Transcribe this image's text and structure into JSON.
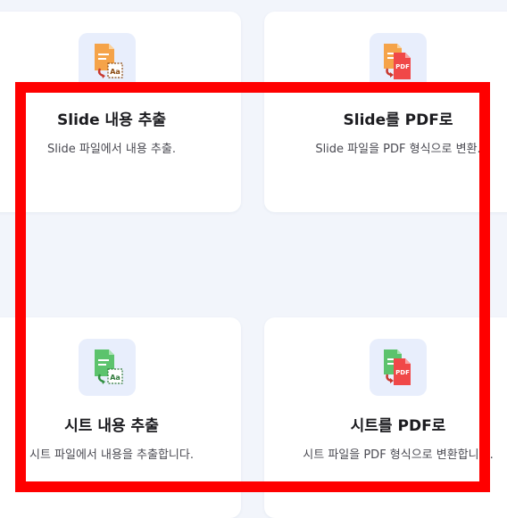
{
  "cards": [
    {
      "title": "Slide 내용 추출",
      "description": "Slide 파일에서 내용 추출.",
      "icon": "slide-extract-icon",
      "doc_color": "#f5a349",
      "badge_text": "Aa"
    },
    {
      "title": "Slide를 PDF로",
      "description": "Slide 파일을 PDF 형식으로 변환.",
      "icon": "slide-to-pdf-icon",
      "doc_color": "#f5a349",
      "badge_text": "PDF"
    },
    {
      "title": "시트 내용 추출",
      "description": "시트 파일에서 내용을 추출합니다.",
      "icon": "sheet-extract-icon",
      "doc_color": "#5cc36d",
      "badge_text": "Aa"
    },
    {
      "title": "시트를 PDF로",
      "description": "시트 파일을 PDF 형식으로 변환합니다.",
      "icon": "sheet-to-pdf-icon",
      "doc_color": "#5cc36d",
      "badge_text": "PDF"
    }
  ],
  "colors": {
    "page_bg": "#f2f5fb",
    "card_bg": "#ffffff",
    "icon_tile_bg": "#e8eefc",
    "pdf_red": "#f04848",
    "arrow_red": "#c8372d",
    "highlight": "#ff0000"
  }
}
